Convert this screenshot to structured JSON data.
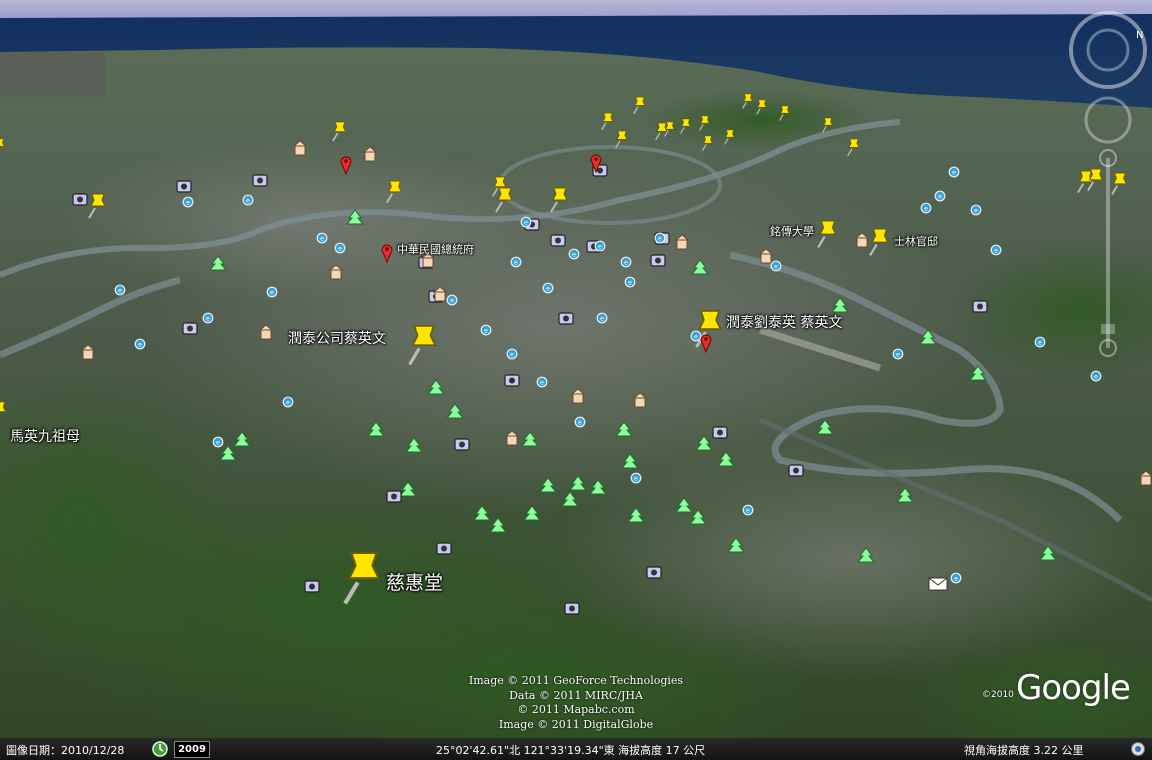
{
  "place_labels": {
    "cihui": "慈惠堂",
    "ma": "馬英九祖母",
    "runtai": "潤泰公司蔡英文",
    "runtai_liu": "潤泰劉泰英 蔡英文",
    "president": "中華民國總統府",
    "mingchuan": "銘傳大學",
    "shilin": "士林官邸"
  },
  "credits": [
    "Image © 2011 GeoForce Technologies",
    "Data © 2011 MIRC/JHA",
    "© 2011 Mapabc.com",
    "Image © 2011 DigitalGlobe"
  ],
  "brand": {
    "copyright": "©2010",
    "logo": "Google"
  },
  "status": {
    "imagery_date": "圖像日期：2010/12/28",
    "year": "2009",
    "coords": "25°02'42.61\"北 121°33'19.34\"東 海拔高度 17 公尺",
    "eye_alt": "視角海拔高度 3.22 公里"
  },
  "icons": {
    "pushpin": "pushpin-icon",
    "tree": "park-tree-icon",
    "camera": "photo-camera-icon",
    "globe": "wikipedia-globe-icon",
    "house": "building-icon",
    "mail": "post-office-icon",
    "red_pin": "red-place-pin-icon"
  },
  "colors": {
    "pushpin": "#ffe600",
    "tree": "#8dfc9a",
    "camera": "#c8c8f0",
    "sea": "#0e2a5a"
  }
}
